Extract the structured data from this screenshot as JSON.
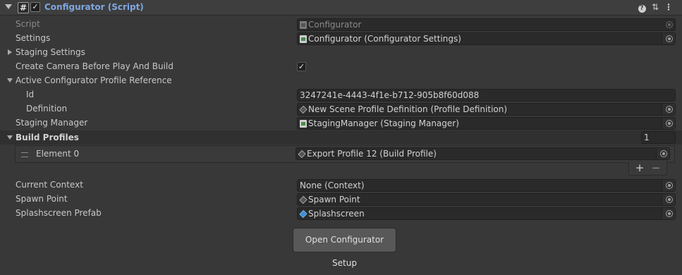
{
  "header": {
    "title": "Configurator (Script)",
    "enabled": true,
    "icons": [
      "script-icon",
      "help-icon",
      "preset-icon",
      "context-menu-icon"
    ]
  },
  "fields": {
    "script": {
      "label": "Script",
      "value": "Configurator",
      "icon": "script-icon"
    },
    "settings": {
      "label": "Settings",
      "value": "Configurator (Configurator Settings)",
      "icon": "script-icon"
    },
    "staging_settings": {
      "label": "Staging Settings",
      "expanded": false
    },
    "create_camera": {
      "label": "Create Camera Before Play And Build",
      "checked": true,
      "check_glyph": "✓"
    },
    "active_profile_ref": {
      "label": "Active Configurator Profile Reference",
      "expanded": true
    },
    "id": {
      "label": "Id",
      "value": "3247241e-4443-4f1e-b712-905b8f60d088"
    },
    "definition": {
      "label": "Definition",
      "value": "New Scene Profile Definition (Profile Definition)",
      "icon": "scriptable-object-icon"
    },
    "staging_manager": {
      "label": "Staging Manager",
      "value": "StagingManager (Staging Manager)",
      "icon": "script-icon"
    },
    "build_profiles": {
      "label": "Build Profiles",
      "size": "1",
      "expanded": true,
      "elements": [
        {
          "label": "Element 0",
          "value": "Export Profile 12 (Build Profile)",
          "icon": "scriptable-object-icon"
        }
      ],
      "add_label": "+",
      "remove_label": "−"
    },
    "current_context": {
      "label": "Current Context",
      "value": "None (Context)"
    },
    "spawn_point": {
      "label": "Spawn Point",
      "value": "Spawn Point",
      "icon": "gameobject-icon"
    },
    "splashscreen_prefab": {
      "label": "Splashscreen Prefab",
      "value": "Splashscreen",
      "icon": "prefab-icon"
    }
  },
  "buttons": {
    "open_setup": "Open Configurator Setup"
  },
  "colors": {
    "background": "#383838",
    "field": "#2a2a2a",
    "title": "#7fa7e0",
    "text": "#c8c8c8"
  }
}
